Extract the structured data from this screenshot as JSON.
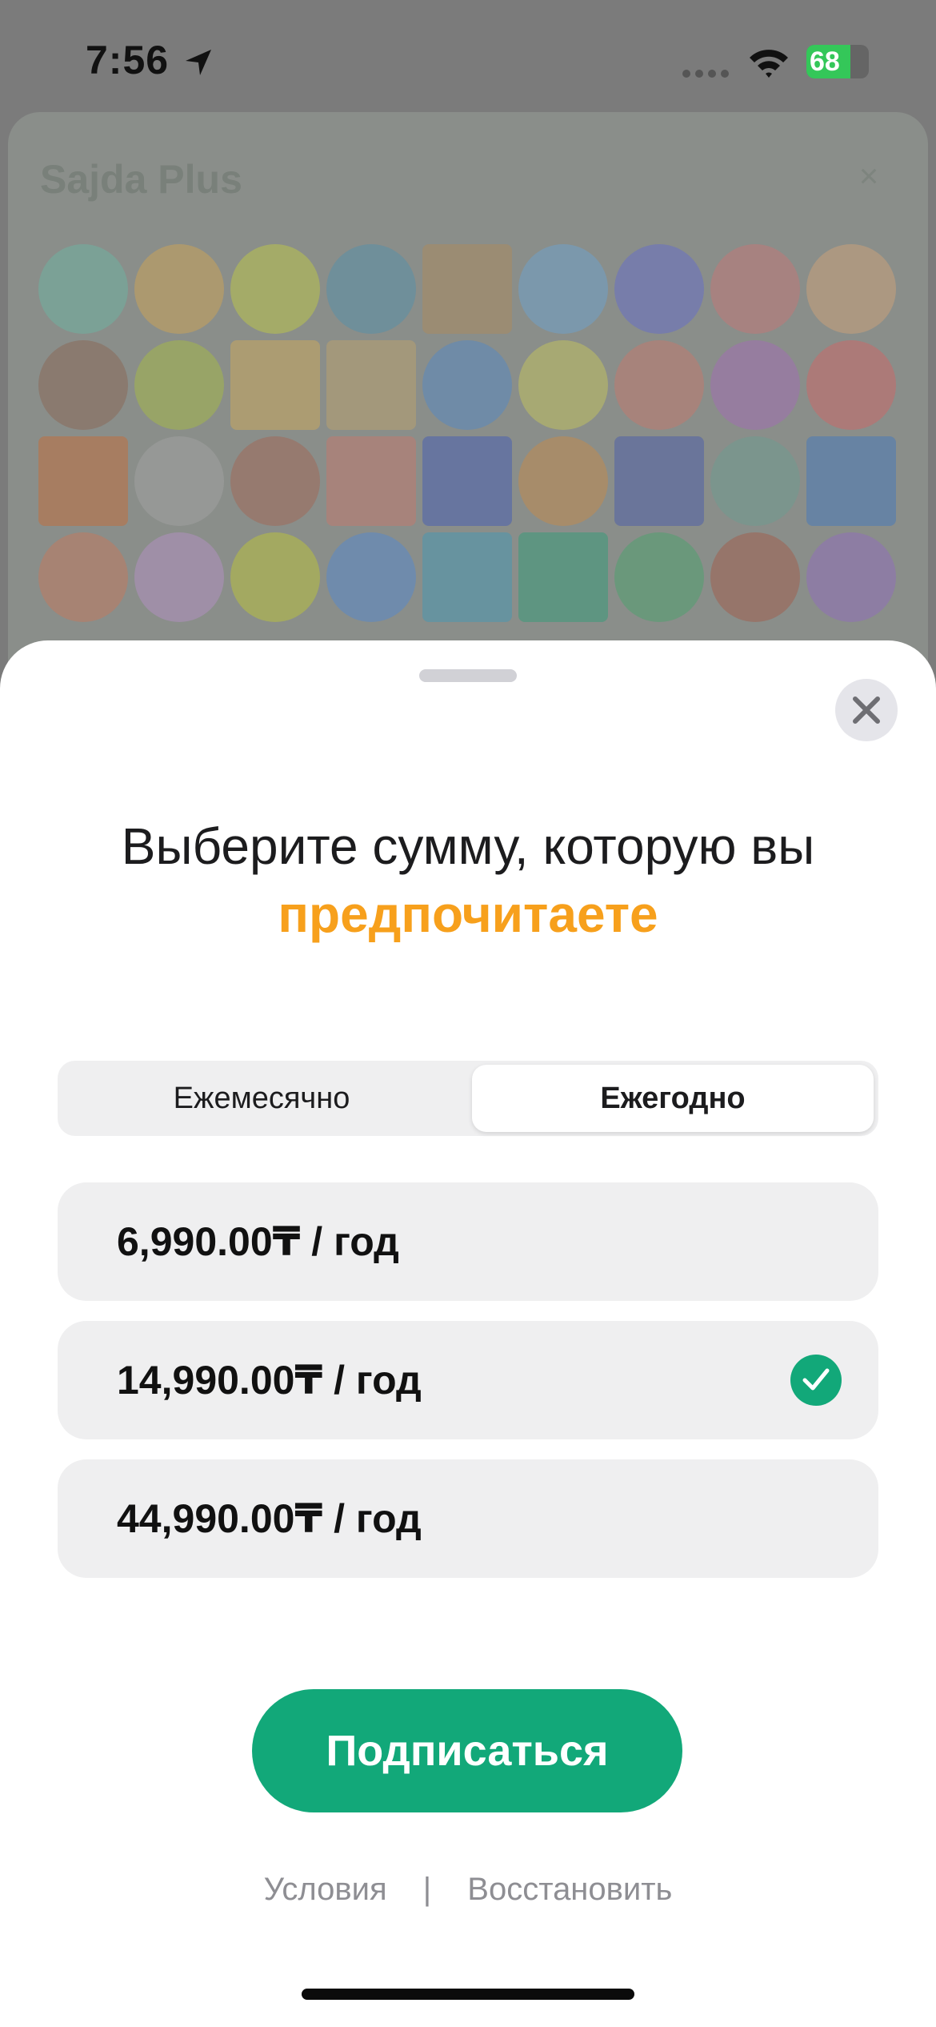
{
  "status_bar": {
    "time": "7:56",
    "battery": "68"
  },
  "background": {
    "app_title": "Sajda Plus"
  },
  "sheet": {
    "headline": "Выберите сумму, которую вы",
    "headline_accent": "предпочитаете",
    "segments": {
      "monthly": "Ежемесячно",
      "yearly": "Ежегодно",
      "selected": "yearly"
    },
    "options": [
      {
        "label": "6,990.00₸ / год",
        "selected": false
      },
      {
        "label": "14,990.00₸ / год",
        "selected": true
      },
      {
        "label": "44,990.00₸ / год",
        "selected": false
      }
    ],
    "subscribe_label": "Подписаться",
    "footer": {
      "terms": "Условия",
      "separator": "|",
      "restore": "Восстановить"
    }
  },
  "colors": {
    "accent_green": "#12a879",
    "accent_orange": "#f7a01c"
  }
}
